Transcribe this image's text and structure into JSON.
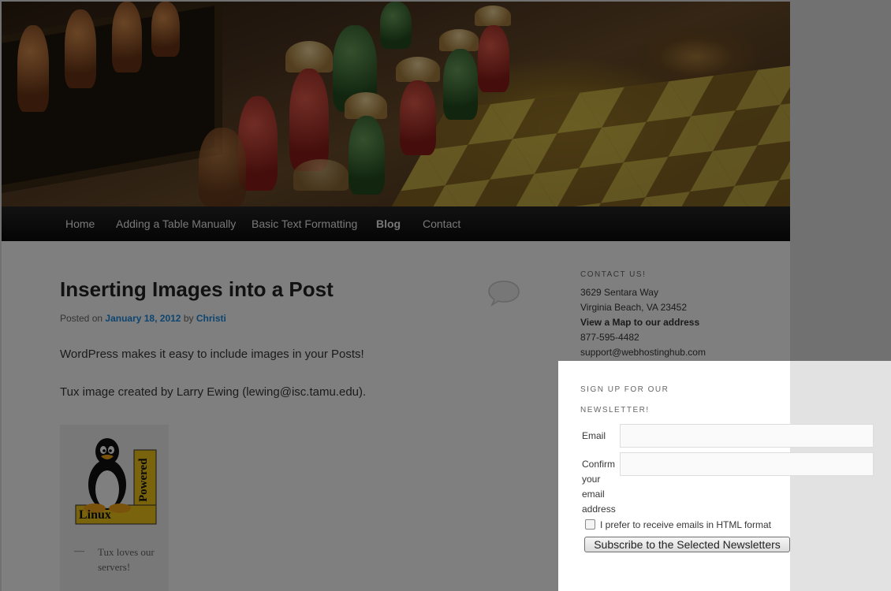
{
  "nav": {
    "items": [
      {
        "label": "Home"
      },
      {
        "label": "Adding a Table Manually"
      },
      {
        "label": "Basic Text Formatting"
      },
      {
        "label": "Blog"
      },
      {
        "label": "Contact"
      }
    ]
  },
  "post": {
    "title": "Inserting Images into a Post",
    "posted_on_prefix": "Posted on",
    "date": "January 18, 2012",
    "by": "by",
    "author": "Christi",
    "paragraph_1": "WordPress makes it easy to include images in your Posts!",
    "paragraph_2": "Tux image created by Larry Ewing (lewing@isc.tamu.edu).",
    "image": {
      "badge_text_vertical": "Powered",
      "badge_text_bottom": "Linux",
      "caption_dash": "—",
      "caption": "Tux loves our servers!"
    }
  },
  "sidebar": {
    "contact": {
      "title": "CONTACT US!",
      "address_line_1": "3629 Sentara Way",
      "address_line_2": "Virginia Beach, VA 23452",
      "map_link": "View a Map to our address",
      "phone": "877-595-4482",
      "email": "support@webhostinghub.com"
    },
    "newsletter": {
      "title_line_1": "SIGN UP FOR OUR",
      "title_line_2": "NEWSLETTER!",
      "email_label": "Email",
      "email_value": "",
      "confirm_label_lines": [
        "Confirm",
        "your",
        "email",
        "address"
      ],
      "confirm_value": "",
      "html_pref_label": "I prefer to receive emails in HTML format",
      "html_pref_checked": false,
      "subscribe_button": "Subscribe to the Selected Newsletters"
    }
  },
  "colors": {
    "link": "#1b8be0",
    "nav_bg": "#111111",
    "overlay": "rgba(0,0,0,0.5)"
  }
}
